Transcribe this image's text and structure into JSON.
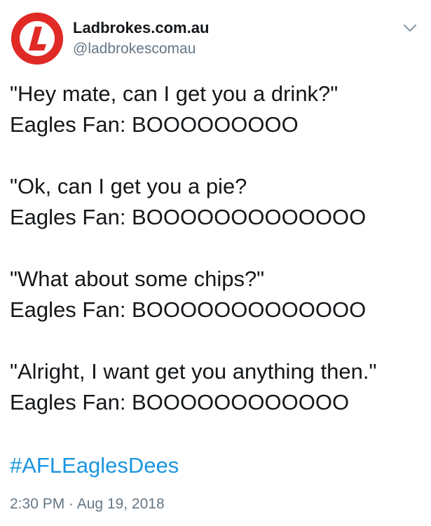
{
  "account": {
    "display_name": "Ladbrokes.com.au",
    "handle": "@ladbrokescomau",
    "avatar_color": "#e02a26",
    "avatar_letter": "L",
    "avatar_icon": "ladbrokes-logo-icon"
  },
  "menu": {
    "icon": "chevron-down-icon"
  },
  "tweet": {
    "stanzas": [
      {
        "line1": "\"Hey mate, can I get you a drink?\"",
        "line2": "Eagles Fan: BOOOOOOOOO"
      },
      {
        "line1": "\"Ok, can I get you a pie?",
        "line2": "Eagles Fan: BOOOOOOOOOOOOO"
      },
      {
        "line1": "\"What about some chips?\"",
        "line2": "Eagles Fan: BOOOOOOOOOOOOO"
      },
      {
        "line1": "\"Alright, I want get you anything then.\"",
        "line2": "Eagles Fan: BOOOOOOOOOOOO"
      }
    ],
    "hashtag": "#AFLEaglesDees",
    "hashtag_color": "#1b95e0",
    "timestamp": "2:30 PM · Aug 19, 2018"
  }
}
